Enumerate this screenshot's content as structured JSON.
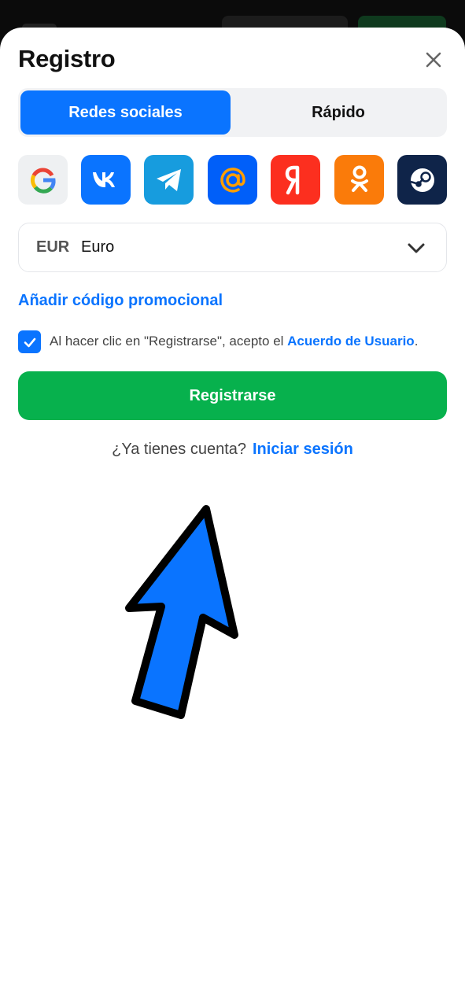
{
  "modal": {
    "title": "Registro"
  },
  "tabs": [
    {
      "label": "Redes sociales",
      "active": true
    },
    {
      "label": "Rápido",
      "active": false
    }
  ],
  "socials": [
    "google-icon",
    "vk-icon",
    "telegram-icon",
    "mailru-icon",
    "yandex-icon",
    "odnoklassniki-icon",
    "steam-icon"
  ],
  "currency": {
    "code": "EUR",
    "name": "Euro"
  },
  "promo": {
    "label": "Añadir código promocional"
  },
  "agreement": {
    "checked": true,
    "text": "Al hacer clic en \"Registrarse\", acepto el ",
    "link": "Acuerdo de Usuario",
    "suffix": "."
  },
  "register_button": {
    "label": "Registrarse"
  },
  "login": {
    "prompt": "¿Ya tienes cuenta?",
    "link": "Iniciar sesión"
  },
  "colors": {
    "accent": "#0a74ff",
    "register": "#07b14d",
    "arrow": "#0a74ff"
  }
}
